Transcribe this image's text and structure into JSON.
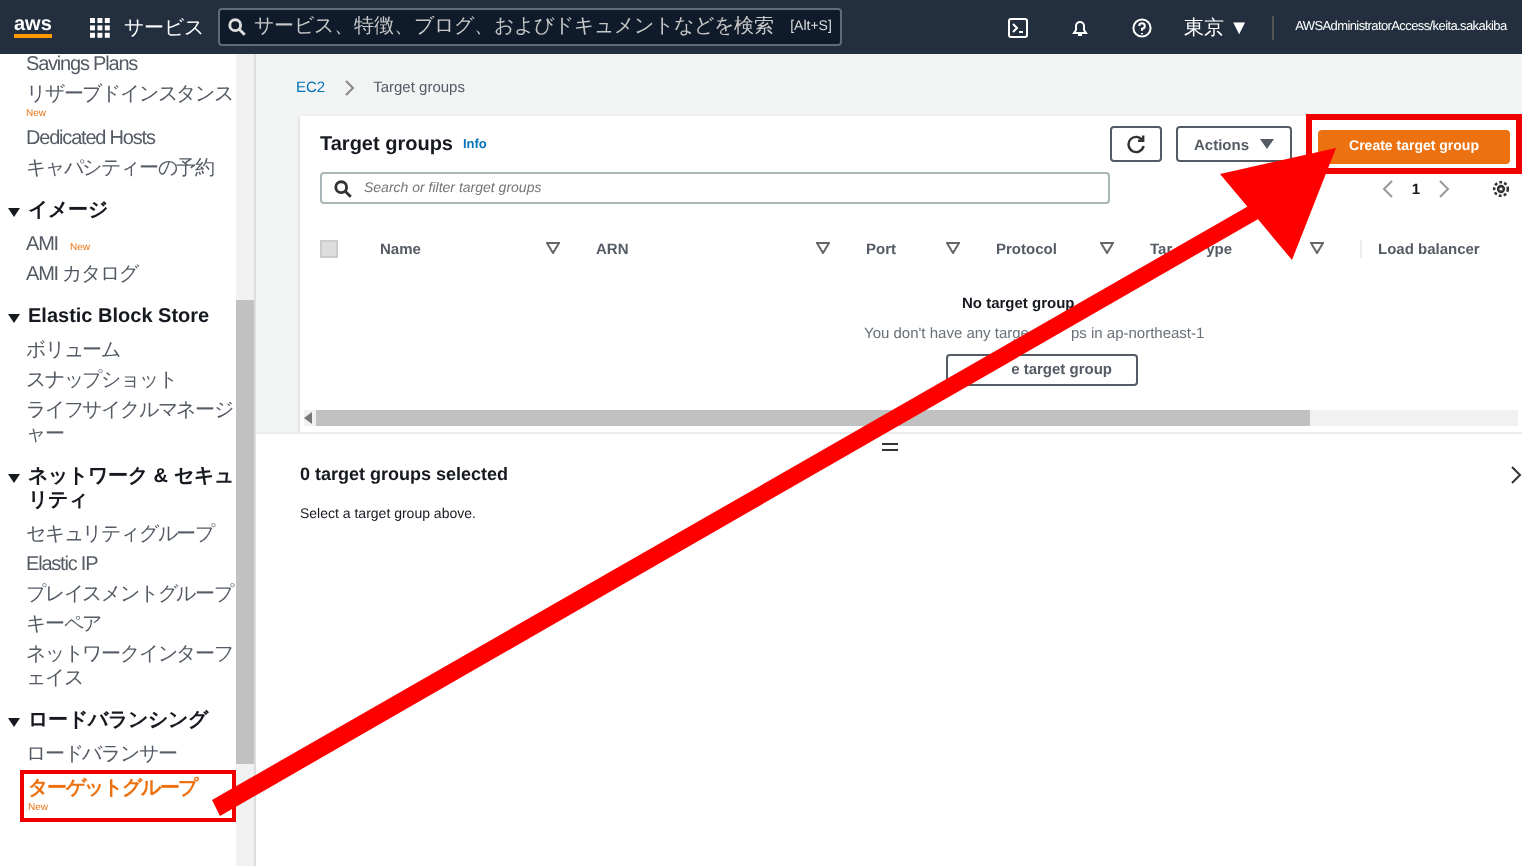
{
  "top_nav": {
    "logo": "aws",
    "services": "サービス",
    "search": {
      "placeholder": "サービス、特徴、ブログ、およびドキュメントなどを検索",
      "shortcut": "[Alt+S]"
    },
    "region": "東京 ▼",
    "account": "AWSAdministratorAccess/keita.sakakiba"
  },
  "sidebar": {
    "groups": [
      {
        "items": [
          {
            "label": "Savings Plans",
            "selected": false,
            "annotated": false
          },
          {
            "label": "リザーブドインスタンス",
            "badge": "New",
            "selected": false,
            "annotated": false
          },
          {
            "label": "Dedicated Hosts",
            "selected": false,
            "annotated": false
          },
          {
            "label": "キャパシティーの予約",
            "selected": false,
            "annotated": false
          }
        ]
      },
      {
        "title": "イメージ",
        "expanded": true,
        "items": [
          {
            "label": "AMI",
            "badge": "New",
            "selected": false,
            "annotated": false
          },
          {
            "label": "AMI カタログ",
            "selected": false,
            "annotated": false
          }
        ]
      },
      {
        "title": "Elastic Block Store",
        "expanded": true,
        "items": [
          {
            "label": "ボリューム",
            "selected": false,
            "annotated": false
          },
          {
            "label": "スナップショット",
            "selected": false,
            "annotated": false
          },
          {
            "label": "ライフサイクルマネージャー",
            "selected": false,
            "annotated": false
          }
        ]
      },
      {
        "title": "ネットワーク & セキュリティ",
        "expanded": true,
        "items": [
          {
            "label": "セキュリティグループ",
            "selected": false,
            "annotated": false
          },
          {
            "label": "Elastic IP",
            "selected": false,
            "annotated": false
          },
          {
            "label": "プレイスメントグループ",
            "selected": false,
            "annotated": false
          },
          {
            "label": "キーペア",
            "selected": false,
            "annotated": false
          },
          {
            "label": "ネットワークインターフェイス",
            "selected": false,
            "annotated": false
          }
        ]
      },
      {
        "title": "ロードバランシング",
        "expanded": true,
        "items": [
          {
            "label": "ロードバランサー",
            "selected": false,
            "annotated": false
          },
          {
            "label": "ターゲットグループ",
            "badge": "New",
            "selected": true,
            "annotated": true
          }
        ]
      }
    ]
  },
  "breadcrumb": [
    {
      "label": "EC2",
      "kind": "link"
    },
    {
      "label": "Target groups",
      "kind": "current"
    }
  ],
  "panel": {
    "title": "Target groups",
    "info": "Info",
    "actions": "Actions",
    "create_button": {
      "label": "Create target group",
      "annotated": true
    },
    "search": {
      "placeholder": "Search or filter target groups"
    },
    "page": "1",
    "select_all": {
      "checked": false
    },
    "columns": [
      {
        "parts": [
          "Name"
        ]
      },
      {
        "parts": [
          "ARN"
        ]
      },
      {
        "parts": [
          "Port"
        ]
      },
      {
        "parts": [
          "Protocol"
        ]
      },
      {
        "parts": [
          "Tar",
          "ype"
        ]
      },
      {
        "parts": [
          "Load balancer"
        ]
      }
    ],
    "empty_title": "No target group",
    "empty_message_parts": [
      "You don't have any targe",
      "ps in ap-northeast-1"
    ],
    "empty_button": "e target group"
  },
  "details": {
    "title": "0 target groups selected",
    "message": "Select a target group above."
  },
  "annotation": {
    "arrow": true
  }
}
